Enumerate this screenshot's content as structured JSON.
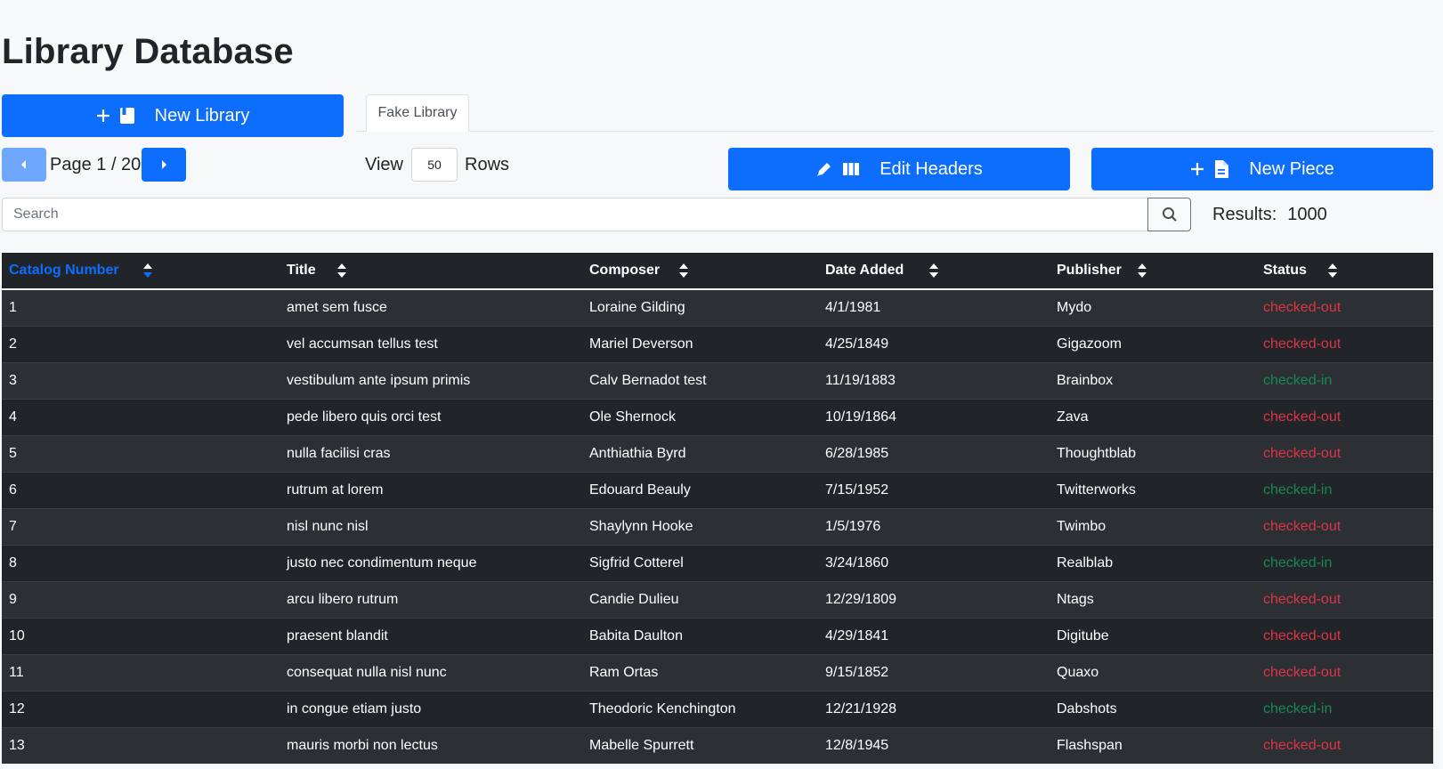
{
  "page": {
    "title": "Library Database"
  },
  "toolbar": {
    "new_library_label": "New Library",
    "edit_headers_label": "Edit Headers",
    "new_piece_label": "New Piece"
  },
  "tabs": [
    {
      "label": "Fake Library",
      "active": true
    }
  ],
  "pagination": {
    "label": "Page 1 / 20",
    "current_page": 1,
    "total_pages": 20
  },
  "view": {
    "label": "View",
    "rows_value": "50",
    "rows_label": "Rows"
  },
  "search": {
    "placeholder": "Search",
    "value": ""
  },
  "results": {
    "label": "Results:",
    "count": "1000"
  },
  "colors": {
    "primary": "#0d6efd",
    "primary_light": "#6ea8fe",
    "checked_out": "#dc3545",
    "checked_in": "#198754",
    "table_dark": "#212529",
    "table_stripe": "#2c3034"
  },
  "table": {
    "sorted_column": "Catalog Number",
    "headers": [
      "Catalog Number",
      "Title",
      "Composer",
      "Date Added",
      "Publisher",
      "Status"
    ],
    "rows": [
      [
        "1",
        "amet sem fusce",
        "Loraine Gilding",
        "4/1/1981",
        "Mydo",
        "checked-out"
      ],
      [
        "2",
        "vel accumsan tellus test",
        "Mariel Deverson",
        "4/25/1849",
        "Gigazoom",
        "checked-out"
      ],
      [
        "3",
        "vestibulum ante ipsum primis",
        "Calv Bernadot test",
        "11/19/1883",
        "Brainbox",
        "checked-in"
      ],
      [
        "4",
        "pede libero quis orci test",
        "Ole Shernock",
        "10/19/1864",
        "Zava",
        "checked-out"
      ],
      [
        "5",
        "nulla facilisi cras",
        "Anthiathia Byrd",
        "6/28/1985",
        "Thoughtblab",
        "checked-out"
      ],
      [
        "6",
        "rutrum at lorem",
        "Edouard Beauly",
        "7/15/1952",
        "Twitterworks",
        "checked-in"
      ],
      [
        "7",
        "nisl nunc nisl",
        "Shaylynn Hooke",
        "1/5/1976",
        "Twimbo",
        "checked-out"
      ],
      [
        "8",
        "justo nec condimentum neque",
        "Sigfrid Cotterel",
        "3/24/1860",
        "Realblab",
        "checked-in"
      ],
      [
        "9",
        "arcu libero rutrum",
        "Candie Dulieu",
        "12/29/1809",
        "Ntags",
        "checked-out"
      ],
      [
        "10",
        "praesent blandit",
        "Babita Daulton",
        "4/29/1841",
        "Digitube",
        "checked-out"
      ],
      [
        "11",
        "consequat nulla nisl nunc",
        "Ram Ortas",
        "9/15/1852",
        "Quaxo",
        "checked-out"
      ],
      [
        "12",
        "in congue etiam justo",
        "Theodoric Kenchington",
        "12/21/1928",
        "Dabshots",
        "checked-in"
      ],
      [
        "13",
        "mauris morbi non lectus",
        "Mabelle Spurrett",
        "12/8/1945",
        "Flashspan",
        "checked-out"
      ]
    ]
  }
}
